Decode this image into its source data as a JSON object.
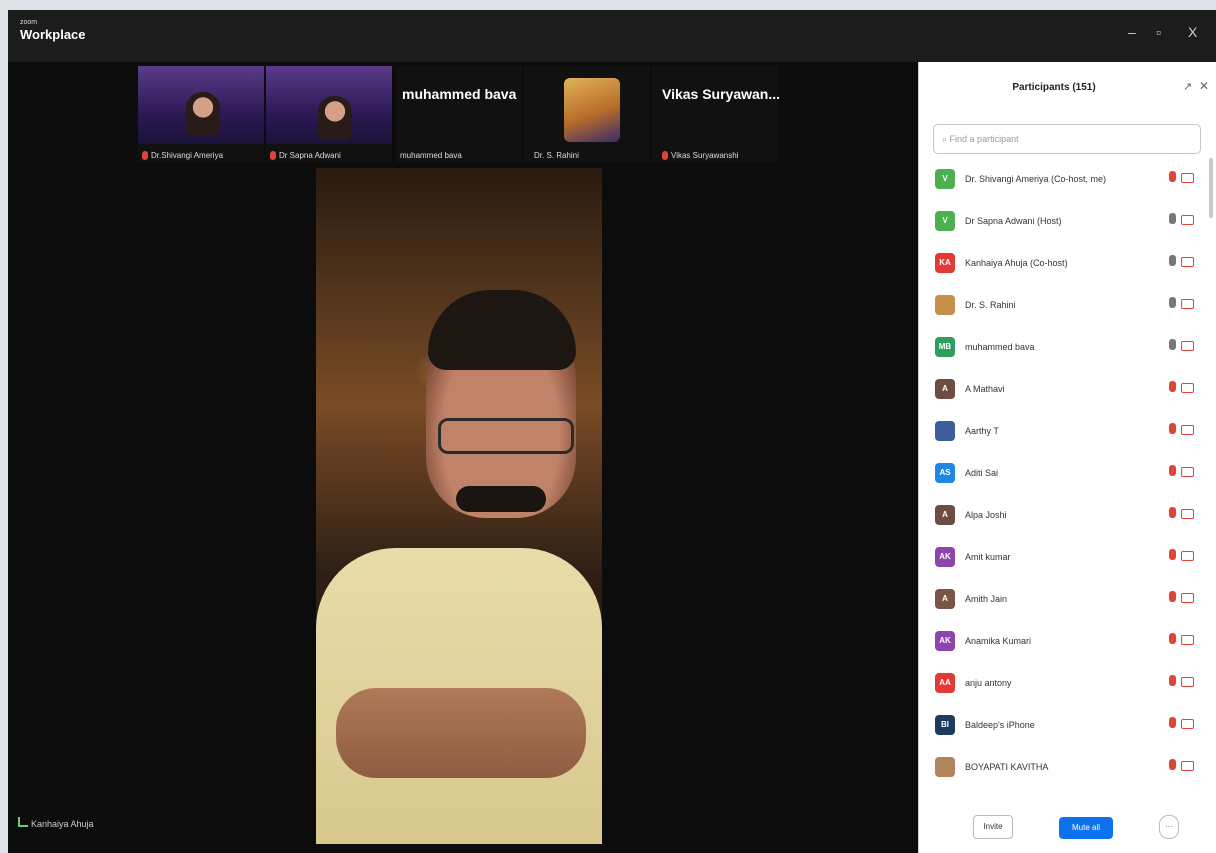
{
  "window": {
    "brand_small": "zoom",
    "brand_big": "Workplace",
    "controls": [
      "–",
      "▫",
      "X"
    ]
  },
  "thumbnails": [
    {
      "label": "Dr.Shivangi Ameriya",
      "muted": true
    },
    {
      "label": "Dr Sapna Adwani",
      "muted": true
    },
    {
      "name_display": "muhammed bava",
      "label": "muhammed bava",
      "muted": false
    },
    {
      "label": "Dr. S. Rahini",
      "muted": false
    },
    {
      "name_display": "Vikas Suryawan...",
      "label": "Vikas Suryawanshi",
      "muted": true
    }
  ],
  "active_speaker_label": "Kanhaiya Ahuja",
  "participants_panel": {
    "title": "Participants (151)",
    "search_placeholder": "Find a participant",
    "items": [
      {
        "initials": "V",
        "color": "#4caf50",
        "name": "Dr. Shivangi Ameriya (Co-host, me)",
        "mic": "muted",
        "cam_on": false
      },
      {
        "initials": "V",
        "color": "#4caf50",
        "name": "Dr Sapna Adwani (Host)",
        "mic": "on",
        "cam_on": false
      },
      {
        "initials": "KA",
        "color": "#e53935",
        "name": "Kanhaiya Ahuja (Co-host)",
        "mic": "on",
        "cam_on": false
      },
      {
        "initials": "",
        "color": "#c8904a",
        "name": "Dr. S. Rahini",
        "mic": "on",
        "cam_on": false
      },
      {
        "initials": "MB",
        "color": "#2e9e5e",
        "name": "muhammed bava",
        "mic": "on",
        "cam_on": false
      },
      {
        "initials": "A",
        "color": "#6d4c41",
        "name": "A Mathavi",
        "mic": "muted",
        "cam_on": false
      },
      {
        "initials": "",
        "color": "#3a5f9a",
        "name": "Aarthy T",
        "mic": "muted",
        "cam_on": false
      },
      {
        "initials": "AS",
        "color": "#1e88e5",
        "name": "Aditi Sai",
        "mic": "muted",
        "cam_on": false
      },
      {
        "initials": "A",
        "color": "#6d4c41",
        "name": "Alpa Joshi",
        "mic": "muted",
        "cam_on": false
      },
      {
        "initials": "AK",
        "color": "#8e44ad",
        "name": "Amit kumar",
        "mic": "muted",
        "cam_on": false
      },
      {
        "initials": "A",
        "color": "#795548",
        "name": "Amith Jain",
        "mic": "muted",
        "cam_on": false
      },
      {
        "initials": "AK",
        "color": "#8e44ad",
        "name": "Anamika Kumari",
        "mic": "muted",
        "cam_on": false
      },
      {
        "initials": "AA",
        "color": "#e53935",
        "name": "anju antony",
        "mic": "muted",
        "cam_on": false
      },
      {
        "initials": "BI",
        "color": "#1f3a5f",
        "name": "Baldeep's iPhone",
        "mic": "muted",
        "cam_on": false
      },
      {
        "initials": "",
        "color": "#b0855e",
        "name": "BOYAPATI KAVITHA",
        "mic": "muted",
        "cam_on": false
      }
    ],
    "buttons": {
      "invite": "Invite",
      "mute_all": "Mute all",
      "more": "···"
    }
  }
}
